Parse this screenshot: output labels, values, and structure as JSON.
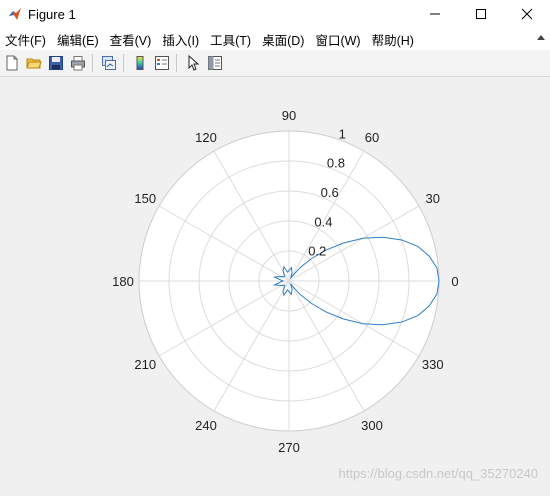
{
  "window": {
    "title": "Figure 1"
  },
  "menu": {
    "items": [
      "文件(F)",
      "编辑(E)",
      "查看(V)",
      "插入(I)",
      "工具(T)",
      "桌面(D)",
      "窗口(W)",
      "帮助(H)"
    ]
  },
  "toolbar": {
    "icons": [
      "new-figure-icon",
      "open-file-icon",
      "save-icon",
      "print-icon",
      "link-plot-icon",
      "insert-colorbar-icon",
      "insert-legend-icon",
      "select-pointer-icon",
      "property-inspector-icon"
    ]
  },
  "colors": {
    "curve": "#2f7fc6",
    "grid": "#dcdcdc",
    "axes_bg": "#ffffff",
    "window_bg": "#f0f0f0"
  },
  "chart_data": {
    "type": "polar-line",
    "theta_ticks": [
      "0",
      "30",
      "60",
      "90",
      "120",
      "150",
      "180",
      "210",
      "240",
      "270",
      "300",
      "330"
    ],
    "r_ticks": [
      "0.2",
      "0.4",
      "0.6",
      "0.8",
      "1"
    ],
    "rlim": [
      0,
      1
    ],
    "grid": true,
    "series": [
      {
        "theta_deg": [
          0,
          5,
          10,
          15,
          20,
          25,
          30,
          35,
          40,
          45,
          50,
          55,
          60,
          70,
          80,
          90,
          100,
          110,
          120,
          135,
          150,
          165,
          180,
          195,
          210,
          225,
          240,
          250,
          260,
          270,
          280,
          290,
          300,
          305,
          310,
          315,
          320,
          325,
          330,
          335,
          340,
          345,
          350,
          355,
          360
        ],
        "r": [
          1.0,
          0.99,
          0.95,
          0.89,
          0.8,
          0.69,
          0.57,
          0.44,
          0.32,
          0.21,
          0.12,
          0.05,
          0.02,
          0.06,
          0.09,
          0.07,
          0.06,
          0.1,
          0.08,
          0.04,
          0.06,
          0.1,
          0.04,
          0.1,
          0.06,
          0.04,
          0.08,
          0.1,
          0.06,
          0.07,
          0.09,
          0.06,
          0.02,
          0.05,
          0.12,
          0.21,
          0.32,
          0.44,
          0.57,
          0.69,
          0.8,
          0.89,
          0.95,
          0.99,
          1.0
        ]
      }
    ]
  },
  "watermark": "https://blog.csdn.net/qq_35270240"
}
